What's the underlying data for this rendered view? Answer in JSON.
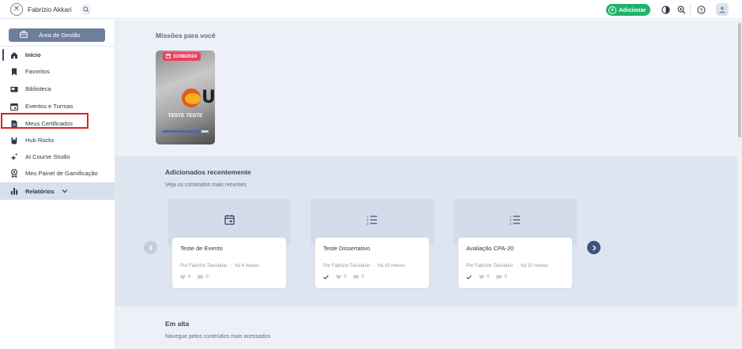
{
  "topbar": {
    "close_icon": "close-icon",
    "user_name": "Fabrizio Akkari",
    "search_icon": "search-icon",
    "add_label": "Adicionar",
    "contrast_icon": "contrast-icon",
    "zoom_icon": "zoom-in-icon",
    "help_icon": "help-icon",
    "avatar_icon": "user-avatar-icon",
    "accent_color": "#1fb26b"
  },
  "sidebar": {
    "management_label": "Área de Gestão",
    "items": [
      {
        "label": "Início",
        "icon": "home-icon"
      },
      {
        "label": "Favoritos",
        "icon": "bookmark-icon"
      },
      {
        "label": "Biblioteca",
        "icon": "library-icon"
      },
      {
        "label": "Eventos e Turmas",
        "icon": "calendar-icon"
      },
      {
        "label": "Meus Certificados",
        "icon": "certificate-icon"
      },
      {
        "label": "Hub Rocks",
        "icon": "rock-hand-icon"
      },
      {
        "label": "AI Course Studio",
        "icon": "sparkles-icon"
      },
      {
        "label": "Meu Painel de Gamificação",
        "icon": "medal-icon"
      },
      {
        "label": "Relatórios",
        "icon": "bar-chart-icon"
      }
    ]
  },
  "missions": {
    "title": "Missões para você",
    "card": {
      "date": "31/08/2024",
      "logo_letter": "U",
      "name": "TESTE TESTE",
      "progress": 0.85
    }
  },
  "recent": {
    "title": "Adicionados recentemente",
    "subtitle": "Veja os conteúdos mais recentes",
    "cards": [
      {
        "title": "Teste de Evento",
        "author": "Por Fabrizio Tassitano",
        "time": "há 4 meses",
        "likes": "0",
        "comments": "0",
        "icon": "calendar-event-icon",
        "completed": false
      },
      {
        "title": "Teste Dissertativo",
        "author": "Por Fabrizio Tassitano",
        "time": "há 10 meses",
        "likes": "0",
        "comments": "0",
        "icon": "numbered-list-icon",
        "completed": true
      },
      {
        "title": "Avaliação CPA-20",
        "author": "Por Fabrizio Tassitano",
        "time": "há 10 meses",
        "likes": "0",
        "comments": "0",
        "icon": "numbered-list-icon",
        "completed": true
      }
    ]
  },
  "trending": {
    "title": "Em alta",
    "subtitle": "Navegue pelos conteúdos mais acessados"
  }
}
